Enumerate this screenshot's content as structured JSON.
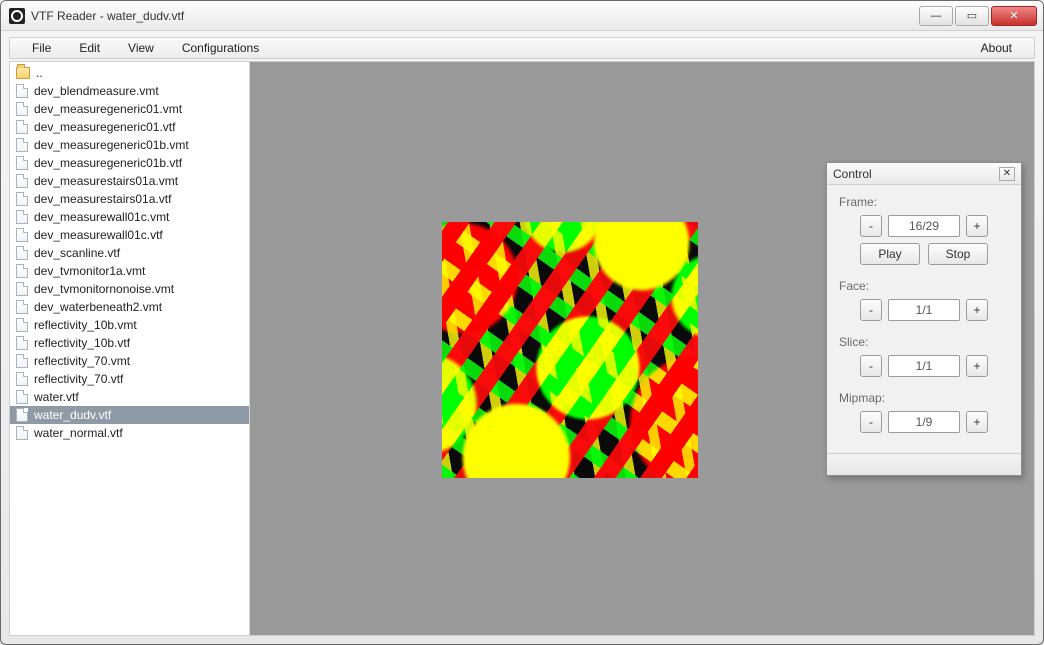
{
  "window": {
    "title": "VTF Reader - water_dudv.vtf"
  },
  "menu": {
    "file": "File",
    "edit": "Edit",
    "view": "View",
    "config": "Configurations",
    "about": "About"
  },
  "sidebar": {
    "parent": "..",
    "items": [
      {
        "name": "dev_blendmeasure.vmt"
      },
      {
        "name": "dev_measuregeneric01.vmt"
      },
      {
        "name": "dev_measuregeneric01.vtf"
      },
      {
        "name": "dev_measuregeneric01b.vmt"
      },
      {
        "name": "dev_measuregeneric01b.vtf"
      },
      {
        "name": "dev_measurestairs01a.vmt"
      },
      {
        "name": "dev_measurestairs01a.vtf"
      },
      {
        "name": "dev_measurewall01c.vmt"
      },
      {
        "name": "dev_measurewall01c.vtf"
      },
      {
        "name": "dev_scanline.vtf"
      },
      {
        "name": "dev_tvmonitor1a.vmt"
      },
      {
        "name": "dev_tvmonitornonoise.vmt"
      },
      {
        "name": "dev_waterbeneath2.vmt"
      },
      {
        "name": "reflectivity_10b.vmt"
      },
      {
        "name": "reflectivity_10b.vtf"
      },
      {
        "name": "reflectivity_70.vmt"
      },
      {
        "name": "reflectivity_70.vtf"
      },
      {
        "name": "water.vtf"
      },
      {
        "name": "water_dudv.vtf",
        "selected": true
      },
      {
        "name": "water_normal.vtf"
      }
    ]
  },
  "control": {
    "title": "Control",
    "frame": {
      "label": "Frame:",
      "value": "16/29",
      "play": "Play",
      "stop": "Stop"
    },
    "face": {
      "label": "Face:",
      "value": "1/1"
    },
    "slice": {
      "label": "Slice:",
      "value": "1/1"
    },
    "mip": {
      "label": "Mipmap:",
      "value": "1/9"
    },
    "minus": "-",
    "plus": "+"
  }
}
